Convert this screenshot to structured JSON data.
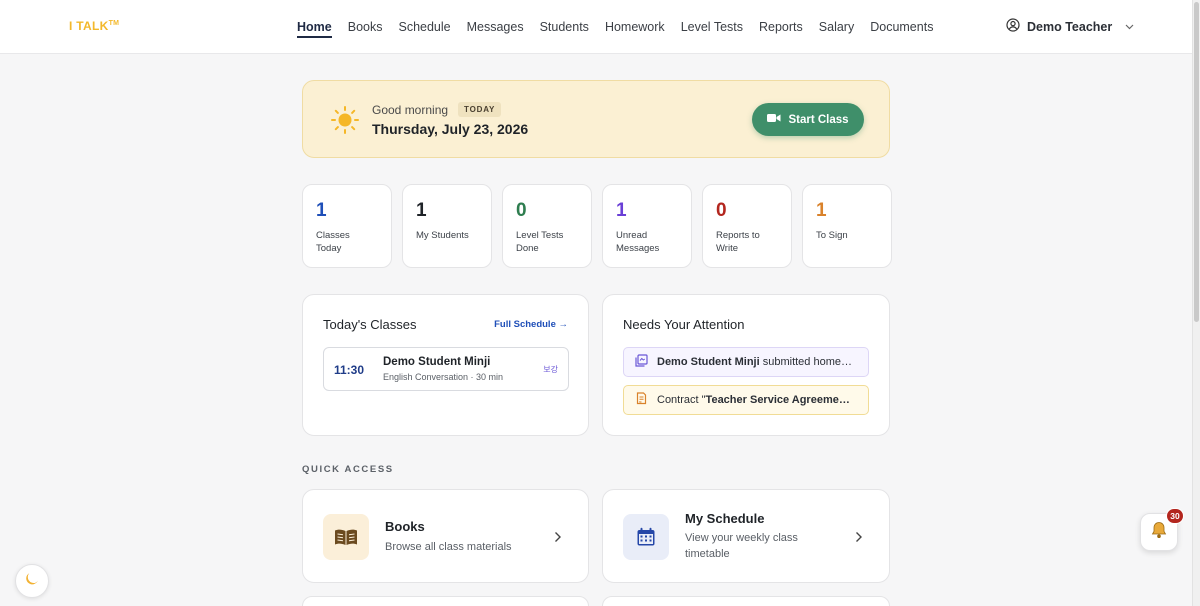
{
  "app": {
    "logo": "I TALK",
    "logo_mark": "TM"
  },
  "nav": {
    "items": [
      "Home",
      "Books",
      "Schedule",
      "Messages",
      "Students",
      "Homework",
      "Level Tests",
      "Reports",
      "Salary",
      "Documents"
    ],
    "active": "Home"
  },
  "user": {
    "name": "Demo Teacher",
    "icon": "user-circle-icon"
  },
  "greeting": {
    "hello": "Good morning",
    "badge": "TODAY",
    "date": "Thursday, July 23, 2026",
    "start_button": "Start Class",
    "start_icon": "video-camera-icon"
  },
  "stats": [
    {
      "value": "1",
      "label": "Classes Today",
      "color": "#1f4fb8"
    },
    {
      "value": "1",
      "label": "My Students",
      "color": "#1f2328"
    },
    {
      "value": "0",
      "label": "Level Tests Done",
      "color": "#2e7d4f"
    },
    {
      "value": "1",
      "label": "Unread Messages",
      "color": "#6a3fd6"
    },
    {
      "value": "0",
      "label": "Reports to Write",
      "color": "#b3261e"
    },
    {
      "value": "1",
      "label": "To Sign",
      "color": "#d9822b"
    }
  ],
  "todays_classes": {
    "title": "Today's Classes",
    "link": "Full Schedule →",
    "items": [
      {
        "time": "11:30",
        "student": "Demo Student Minji",
        "detail": "English Conversation · 30 min",
        "tag": "보강"
      }
    ]
  },
  "attention": {
    "title": "Needs Your Attention",
    "items": [
      {
        "bold": "Demo Student Minji",
        "rest": " submitted home…",
        "icon": "homework-icon"
      },
      {
        "prefix": "Contract \"",
        "bold": "Teacher Service Agreeme…",
        "icon": "contract-icon"
      }
    ]
  },
  "quick_access": {
    "label": "QUICK ACCESS",
    "cards": [
      {
        "title": "Books",
        "subtitle": "Browse all class materials",
        "icon": "book-icon"
      },
      {
        "title": "My Schedule",
        "subtitle": "View your weekly class timetable",
        "icon": "calendar-icon"
      }
    ]
  },
  "floating": {
    "theme_icon": "moon-icon",
    "bell_icon": "bell-icon",
    "notifications": "30"
  },
  "colors": {
    "accent_green": "#3f8f6a",
    "banner_bg": "#fbf0d3",
    "logo": "#f3b82b"
  }
}
